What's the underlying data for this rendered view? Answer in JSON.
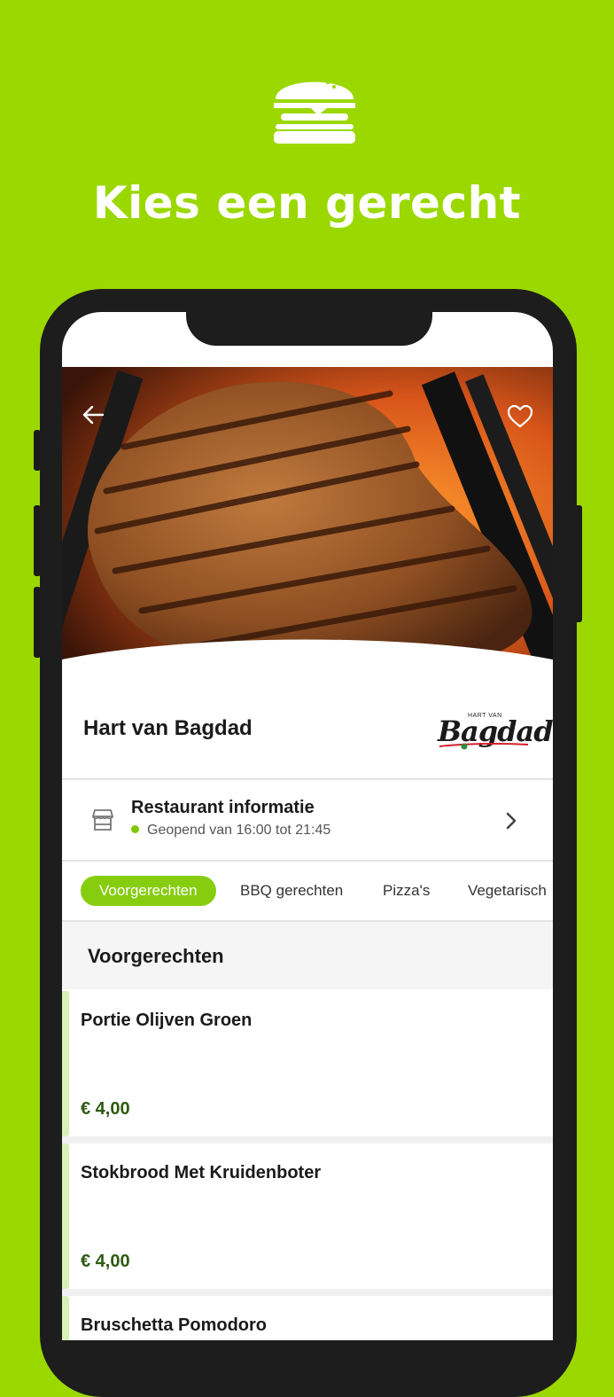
{
  "promo": {
    "icon": "burger-icon",
    "headline": "Kies een gerecht"
  },
  "header": {
    "back_icon": "arrow-left-icon",
    "favorite_icon": "heart-icon"
  },
  "restaurant": {
    "name": "Hart van Bagdad",
    "logo_small_text": "HART VAN",
    "logo_script_text": "Bagdad"
  },
  "info": {
    "icon": "store-icon",
    "title": "Restaurant informatie",
    "status": "Geopend van 16:00 tot 21:45",
    "status_color": "#7fc800",
    "chevron_icon": "chevron-right-icon"
  },
  "tabs": [
    {
      "label": "Voorgerechten",
      "active": true
    },
    {
      "label": "BBQ gerechten",
      "active": false
    },
    {
      "label": "Pizza's",
      "active": false
    },
    {
      "label": "Vegetarisch",
      "active": false
    }
  ],
  "section": {
    "title": "Voorgerechten"
  },
  "dishes": [
    {
      "name": "Portie Olijven Groen",
      "price": "€ 4,00"
    },
    {
      "name": "Stokbrood Met Kruidenboter",
      "price": "€ 4,00"
    },
    {
      "name": "Bruschetta Pomodoro",
      "price": ""
    }
  ],
  "colors": {
    "background": "#9bd800",
    "accent": "#86cd0f",
    "price": "#2d5a10",
    "phone_frame": "#1d1d1d"
  }
}
